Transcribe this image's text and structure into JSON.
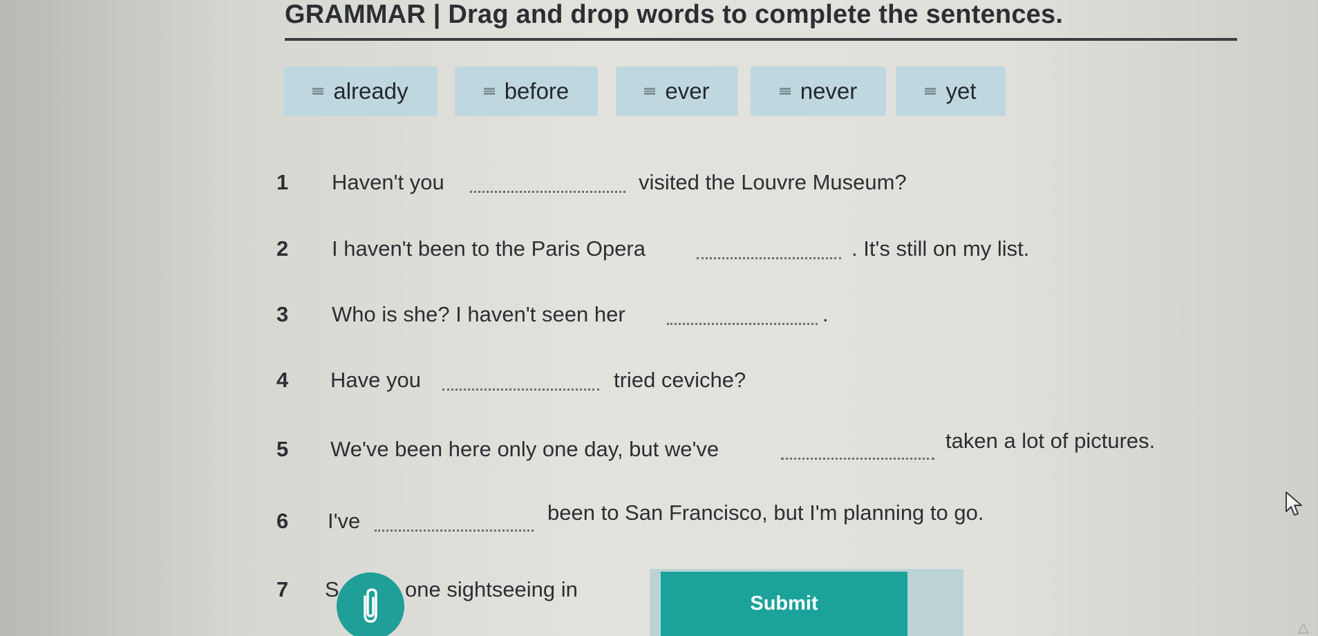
{
  "header": {
    "title": "GRAMMAR | Drag and drop words to complete the sentences."
  },
  "word_bank": {
    "items": [
      {
        "label": "already"
      },
      {
        "label": "before"
      },
      {
        "label": "ever"
      },
      {
        "label": "never"
      },
      {
        "label": "yet"
      }
    ]
  },
  "sentences": [
    {
      "number": "1",
      "before": "Haven't you",
      "after": "visited the Louvre Museum?"
    },
    {
      "number": "2",
      "before": "I haven't been to the Paris Opera",
      "after": ". It's still on my list."
    },
    {
      "number": "3",
      "before": "Who is she? I haven't seen her",
      "after": "."
    },
    {
      "number": "4",
      "before": "Have you",
      "after": "tried ceviche?"
    },
    {
      "number": "5",
      "before": "We've been here only one day, but we've",
      "after": "taken a lot of pictures."
    },
    {
      "number": "6",
      "before": "I've",
      "after": "been to San Francisco, but I'm planning to go."
    },
    {
      "number": "7",
      "before": "S",
      "after": "one sightseeing in"
    }
  ],
  "actions": {
    "submit_label": "Submit"
  },
  "icons": {
    "drag_grip": "drag-handle-icon",
    "attach": "paperclip-icon",
    "cursor": "mouse-pointer-icon"
  },
  "colors": {
    "chip_bg": "#bfd8e0",
    "accent": "#1aa29b",
    "text": "#2b2f33"
  }
}
